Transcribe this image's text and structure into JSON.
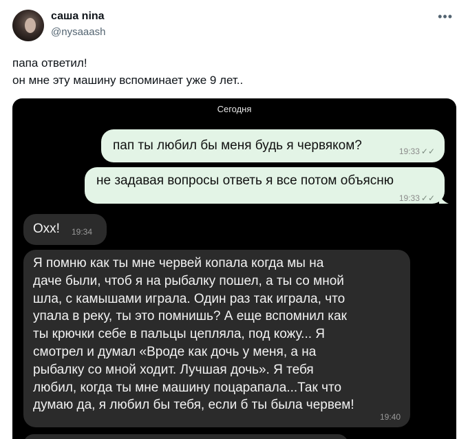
{
  "author": {
    "name": "саша nina",
    "handle": "@nysaaash"
  },
  "more_icon": "•••",
  "tweet": {
    "lines": [
      "папа ответил!",
      "он мне эту машину вспоминает уже 9 лет.."
    ]
  },
  "chat": {
    "date_label": "Сегодня",
    "messages": [
      {
        "direction": "outgoing",
        "text": "пап ты любил бы меня будь я червяком?",
        "time": "19:33",
        "status_icon": "double-check-icon"
      },
      {
        "direction": "outgoing",
        "text": "не задавая вопросы ответь я все потом объясню",
        "time": "19:33",
        "status_icon": "double-check-icon"
      },
      {
        "direction": "incoming",
        "text": "Охх!",
        "time": "19:34"
      },
      {
        "direction": "incoming",
        "lines": [
          "Я помню как ты мне червей копала когда мы на",
          "даче были, чтоб я на рыбалку пошел, а ты со мной",
          "шла, с камышами играла. Один раз так играла, что",
          "упала в реку, ты это помнишь? А еще вспомнил как",
          "ты крючки себе в пальцы цепляла, под кожу... Я",
          "смотрел и думал «Вроде как дочь у меня, а на",
          "рыбалку со мной ходит. Лучшая дочь». Я тебя",
          "любил, когда ты мне машину поцарапала...Так что",
          "думаю да, я любил бы тебя, если б ты была червем!"
        ],
        "time": "19:40"
      }
    ]
  }
}
